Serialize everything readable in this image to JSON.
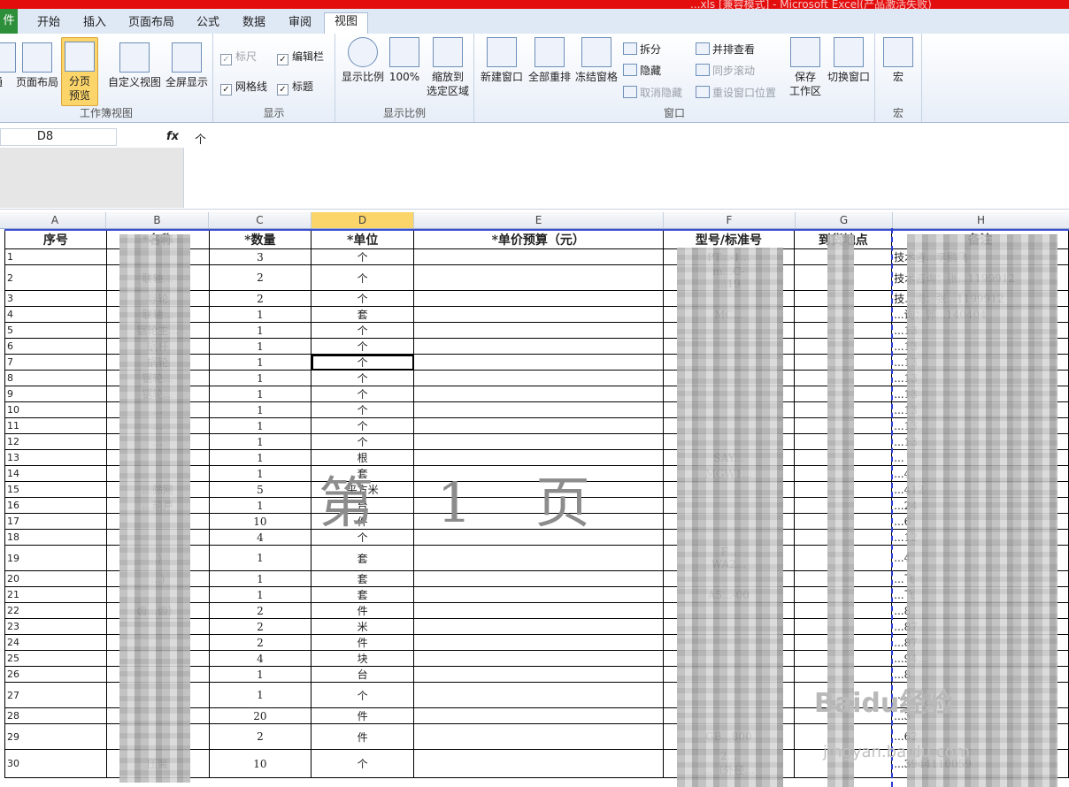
{
  "window": {
    "title": "...xls [兼容模式] - Microsoft Excel(产品激活失败)"
  },
  "tabs": [
    {
      "label": "件"
    },
    {
      "label": "开始"
    },
    {
      "label": "插入"
    },
    {
      "label": "页面布局"
    },
    {
      "label": "公式"
    },
    {
      "label": "数据"
    },
    {
      "label": "审阅"
    },
    {
      "label": "视图"
    }
  ],
  "ribbon": {
    "workbook_views": {
      "label": "工作簿视图",
      "normal": "通",
      "page_layout": "页面布局",
      "page_break": "分页\n预览",
      "custom_view": "自定义视图",
      "full_screen": "全屏显示"
    },
    "show": {
      "label": "显示",
      "ruler": "标尺",
      "formula_bar": "编辑栏",
      "gridlines": "网格线",
      "headings": "标题"
    },
    "zoom": {
      "label": "显示比例",
      "zoom": "显示比例",
      "hundred": "100%",
      "zoom_selection": "缩放到\n选定区域"
    },
    "window": {
      "label": "窗口",
      "new_window": "新建窗口",
      "arrange_all": "全部重排",
      "freeze": "冻结窗格",
      "split": "拆分",
      "hide": "隐藏",
      "unhide": "取消隐藏",
      "side_by_side": "并排查看",
      "sync_scroll": "同步滚动",
      "reset_pos": "重设窗口位置",
      "save_workspace": "保存\n工作区",
      "switch_windows": "切换窗口"
    },
    "macros": {
      "label": "宏",
      "macros": "宏"
    }
  },
  "formula_bar": {
    "name_box": "D8",
    "fx": "fx",
    "value": "个"
  },
  "columns": [
    "A",
    "B",
    "C",
    "D",
    "E",
    "F",
    "G",
    "H"
  ],
  "sheet": {
    "headers": [
      "序号",
      "*名称",
      "*数量",
      "*单位",
      "*单价预算（元）",
      "型号/标准号",
      "到货地点",
      "备注"
    ],
    "rows": [
      [
        "1",
        "",
        "3",
        "个",
        "",
        "PT...-1...",
        "",
        "技术咨...李鹏飞"
      ],
      [
        "2",
        "联轴...",
        "2",
        "个",
        "",
        "m...C-\n...19",
        "",
        "技术咨询：张...1199912"
      ],
      [
        "3",
        "导轮",
        "2",
        "个",
        "",
        "",
        "",
        "技...询：张...1199912"
      ],
      [
        "4",
        "联轴...",
        "1",
        "套",
        "",
        "MC...",
        "",
        "...询：郭...140404"
      ],
      [
        "5",
        "锯轮主...",
        "1",
        "个",
        "",
        "",
        "",
        "...13"
      ],
      [
        "6",
        "蜗杆",
        "1",
        "个",
        "",
        "",
        "",
        "...13"
      ],
      [
        "7",
        "蜗轮",
        "1",
        "个",
        "",
        "",
        "",
        "...13"
      ],
      [
        "8",
        "锯轮...",
        "1",
        "个",
        "",
        "",
        "",
        "...13"
      ],
      [
        "9",
        "锯轮...",
        "1",
        "个",
        "",
        "",
        "",
        "...13"
      ],
      [
        "10",
        "...",
        "1",
        "个",
        "",
        "",
        "",
        "...13"
      ],
      [
        "11",
        "...",
        "1",
        "个",
        "",
        "",
        "",
        "...13"
      ],
      [
        "12",
        "...",
        "1",
        "个",
        "",
        "",
        "",
        "...13"
      ],
      [
        "13",
        "",
        "1",
        "根",
        "",
        "SAY...",
        "",
        "..."
      ],
      [
        "14",
        "",
        "1",
        "套",
        "",
        "MGW1...",
        "",
        "...4"
      ],
      [
        "15",
        "...筛网",
        "5",
        "平方米",
        "",
        "",
        "",
        "...412"
      ],
      [
        "16",
        "...葫芦",
        "1",
        "台",
        "",
        "",
        "",
        "...24"
      ],
      [
        "17",
        "",
        "10",
        "件",
        "",
        "",
        "",
        "...6"
      ],
      [
        "18",
        "",
        "4",
        "个",
        "",
        "",
        "",
        "...12"
      ],
      [
        "19",
        "...）",
        "1",
        "套",
        "",
        "F...\nWA2...",
        "",
        "...4"
      ],
      [
        "20",
        "...)",
        "1",
        "套",
        "",
        "",
        "",
        "...飞"
      ],
      [
        "21",
        "",
        "1",
        "套",
        "",
        "A5...-00",
        "",
        "...飞"
      ],
      [
        "22",
        "齿...齿）",
        "2",
        "件",
        "",
        "",
        "",
        "...8"
      ],
      [
        "23",
        "",
        "2",
        "米",
        "",
        "",
        "",
        "...87"
      ],
      [
        "24",
        "",
        "2",
        "件",
        "",
        "",
        "",
        "...87"
      ],
      [
        "25",
        "",
        "4",
        "块",
        "",
        "",
        "",
        "...94..."
      ],
      [
        "26",
        "",
        "1",
        "台",
        "",
        "",
        "",
        "...8"
      ],
      [
        "27",
        "",
        "1",
        "个",
        "",
        "",
        "",
        "...3"
      ],
      [
        "28",
        "",
        "20",
        "件",
        "",
        "",
        "",
        "...3"
      ],
      [
        "29",
        "",
        "2",
        "件",
        "",
        "GB...800",
        "",
        "...62"
      ],
      [
        "30",
        "压簧",
        "10",
        "个",
        "",
        "2...\n...（外径...",
        "",
        "...3944110059"
      ]
    ]
  },
  "overlay": {
    "page_label": "第 1 页",
    "watermark": "Baidu经验",
    "watermark_url": "jingyan.baidu.com"
  }
}
